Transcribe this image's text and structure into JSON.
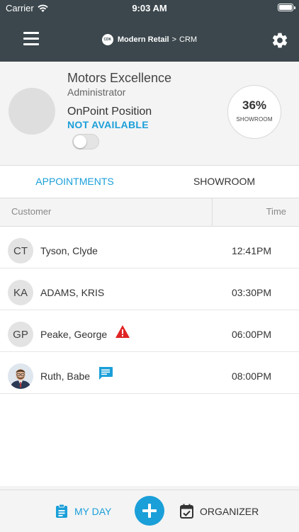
{
  "status_bar": {
    "carrier": "Carrier",
    "time": "9:03 AM"
  },
  "nav": {
    "logo_text": "CDK",
    "brand": "Modern Retail",
    "separator": ">",
    "section": "CRM"
  },
  "profile": {
    "name": "Motors Excellence",
    "role": "Administrator",
    "position_label": "OnPoint Position",
    "position_status": "NOT AVAILABLE",
    "available_toggle": false,
    "showroom_percent": "36%",
    "showroom_label": "SHOWROOM"
  },
  "tabs": [
    {
      "label": "APPOINTMENTS",
      "active": true
    },
    {
      "label": "SHOWROOM",
      "active": false
    }
  ],
  "table": {
    "columns": {
      "customer": "Customer",
      "time": "Time"
    },
    "rows": [
      {
        "initials": "CT",
        "name": "Tyson, Clyde",
        "time": "12:41PM",
        "indicator": null
      },
      {
        "initials": "KA",
        "name": "ADAMS, KRIS",
        "time": "03:30PM",
        "indicator": null
      },
      {
        "initials": "GP",
        "name": "Peake, George",
        "time": "06:00PM",
        "indicator": "warning-icon"
      },
      {
        "initials": "",
        "name": "Ruth, Babe",
        "time": "08:00PM",
        "indicator": "message-icon",
        "has_photo": true
      }
    ]
  },
  "bottom_bar": {
    "my_day_label": "MY DAY",
    "organizer_label": "ORGANIZER"
  },
  "colors": {
    "header_bg": "#3b474d",
    "accent": "#1a9fd9",
    "warning": "#e02424"
  }
}
